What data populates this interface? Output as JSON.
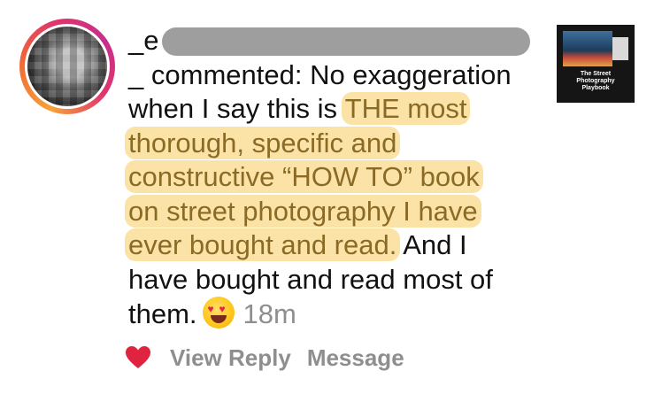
{
  "comment": {
    "username_start": "_e",
    "username_end": "_",
    "verb": "commented:",
    "text_plain_1": "No exaggeration",
    "text_plain_2": "when I say this is",
    "hl_1": "THE most",
    "hl_2": "thorough, specific and",
    "hl_3": "constructive “HOW TO” book",
    "hl_4": "on street photography I have",
    "hl_5": "ever bought and read.",
    "text_after_hl": "And I",
    "text_line_7": "have bought and read most of",
    "text_line_8": "them.",
    "emoji": "heart-eyes-emoji",
    "timestamp": "18m"
  },
  "actions": {
    "like_icon": "heart-icon",
    "like_color": "#e0243f",
    "view_reply": "View Reply",
    "message": "Message"
  },
  "thumbnail": {
    "title_line_1": "The Street",
    "title_line_2": "Photography",
    "title_line_3": "Playbook"
  },
  "colors": {
    "highlight_bg": "#fbe3a8",
    "highlight_text": "#8a6a25",
    "muted_text": "#8e8e8e"
  }
}
